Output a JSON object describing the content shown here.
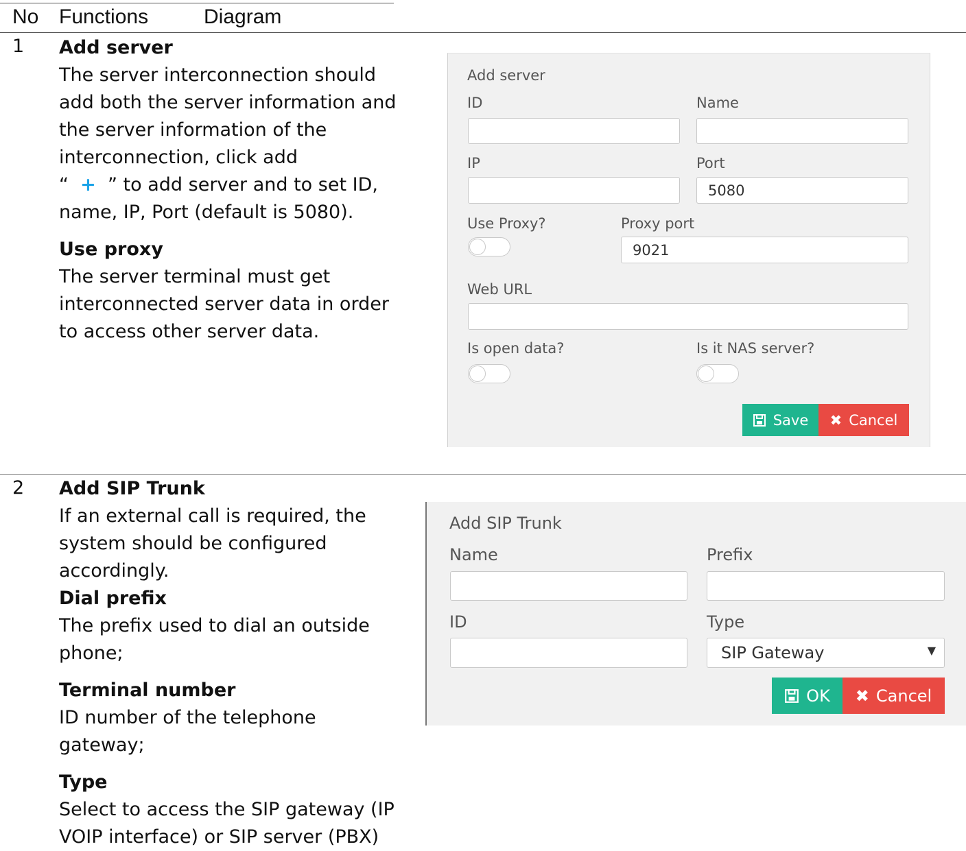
{
  "table_header": {
    "no": "No",
    "functions": "Functions",
    "diagram": "Diagram"
  },
  "rows": [
    {
      "no": "1",
      "title": "Add server",
      "desc_before_icon": "The server interconnection should add both the server information and the server information of the interconnection, click add",
      "icon_quote_open": "“",
      "icon_glyph": "+",
      "icon_quote_close": "”",
      "desc_after_icon": " to add server and to set ID, name, IP, Port (default is 5080).",
      "sub_title": "Use proxy",
      "sub_desc": "The server terminal must get interconnected server data in order to access other server data."
    },
    {
      "no": "2",
      "title": "Add SIP Trunk",
      "desc": "If an external call is required, the system should be configured accordingly.",
      "sub1_title": "Dial prefix",
      "sub1_desc": "The prefix used to dial an outside phone;",
      "sub2_title": "Terminal number",
      "sub2_desc": "ID number of the telephone gateway;",
      "sub3_title": "Type",
      "sub3_desc": "Select to access the SIP gateway (IP VOIP interface) or SIP server (PBX)"
    }
  ],
  "add_server_form": {
    "title": "Add server",
    "id_label": "ID",
    "id_value": "",
    "name_label": "Name",
    "name_value": "",
    "ip_label": "IP",
    "ip_value": "",
    "port_label": "Port",
    "port_value": "5080",
    "use_proxy_label": "Use Proxy?",
    "use_proxy_on": false,
    "proxy_port_label": "Proxy port",
    "proxy_port_value": "9021",
    "web_url_label": "Web URL",
    "web_url_value": "",
    "open_data_label": "Is open data?",
    "open_data_on": false,
    "nas_label": "Is it NAS server?",
    "nas_on": false,
    "save_label": "Save",
    "cancel_label": "Cancel"
  },
  "add_sip_form": {
    "title": "Add SIP Trunk",
    "name_label": "Name",
    "name_value": "",
    "prefix_label": "Prefix",
    "prefix_value": "",
    "id_label": "ID",
    "id_value": "",
    "type_label": "Type",
    "type_value": "SIP Gateway",
    "ok_label": "OK",
    "cancel_label": "Cancel"
  },
  "colors": {
    "green": "#1fb58f",
    "red": "#e94a43",
    "panel": "#f1f1f1",
    "accent": "#1aa3e8"
  }
}
